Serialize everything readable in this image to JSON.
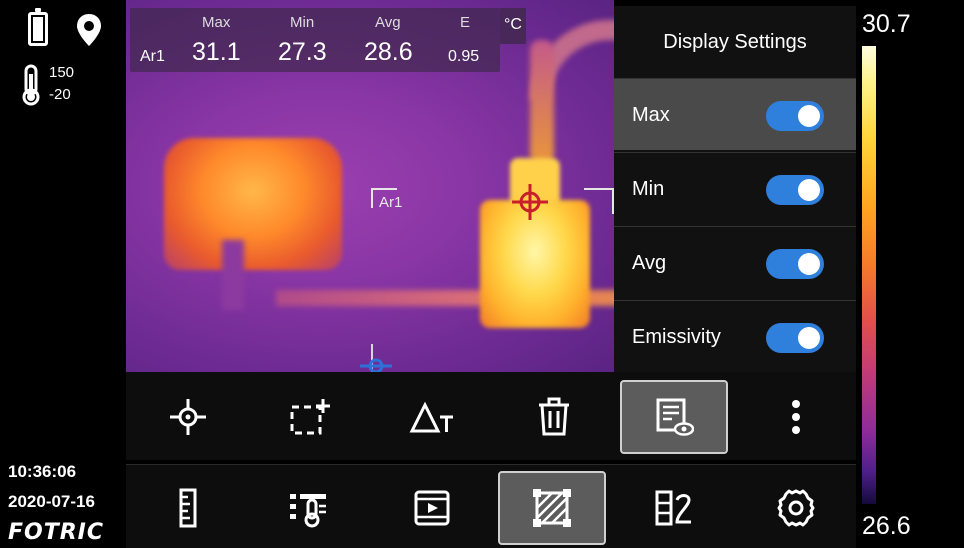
{
  "status": {
    "battery_icon": "battery-full-icon",
    "location_icon": "location-pin-icon",
    "range_icon": "thermometer-icon",
    "range_max": "150",
    "range_min": "-20",
    "time": "10:36:06",
    "date": "2020-07-16",
    "brand": "FOTRIC"
  },
  "measurement": {
    "headers": {
      "max": "Max",
      "min": "Min",
      "avg": "Avg",
      "e": "E"
    },
    "area_label": "Ar1",
    "max": "31.1",
    "min": "27.3",
    "avg": "28.6",
    "emissivity": "0.95",
    "unit": "°C"
  },
  "roi_label": "Ar1",
  "settings_panel": {
    "title": "Display Settings",
    "items": [
      {
        "label": "Max",
        "enabled": true,
        "selected": true
      },
      {
        "label": "Min",
        "enabled": true,
        "selected": false
      },
      {
        "label": "Avg",
        "enabled": true,
        "selected": false
      },
      {
        "label": "Emissivity",
        "enabled": true,
        "selected": false
      }
    ],
    "toggle_color": "#2f7fdc"
  },
  "color_scale": {
    "max": "30.7",
    "min": "26.6"
  },
  "toolbar_top": [
    {
      "icon": "crosshair-spot-icon",
      "active": false
    },
    {
      "icon": "add-area-icon",
      "active": false
    },
    {
      "icon": "delta-temperature-icon",
      "active": false
    },
    {
      "icon": "trash-icon",
      "active": false
    },
    {
      "icon": "display-settings-icon",
      "active": true
    },
    {
      "icon": "more-vertical-icon",
      "active": false
    }
  ],
  "toolbar_bottom": [
    {
      "icon": "ruler-icon",
      "active": false
    },
    {
      "icon": "thermometer-settings-icon",
      "active": false
    },
    {
      "icon": "video-file-icon",
      "active": false
    },
    {
      "icon": "area-hatch-icon",
      "active": true
    },
    {
      "icon": "palette-edit-icon",
      "active": false
    },
    {
      "icon": "settings-gear-icon",
      "active": false
    }
  ]
}
